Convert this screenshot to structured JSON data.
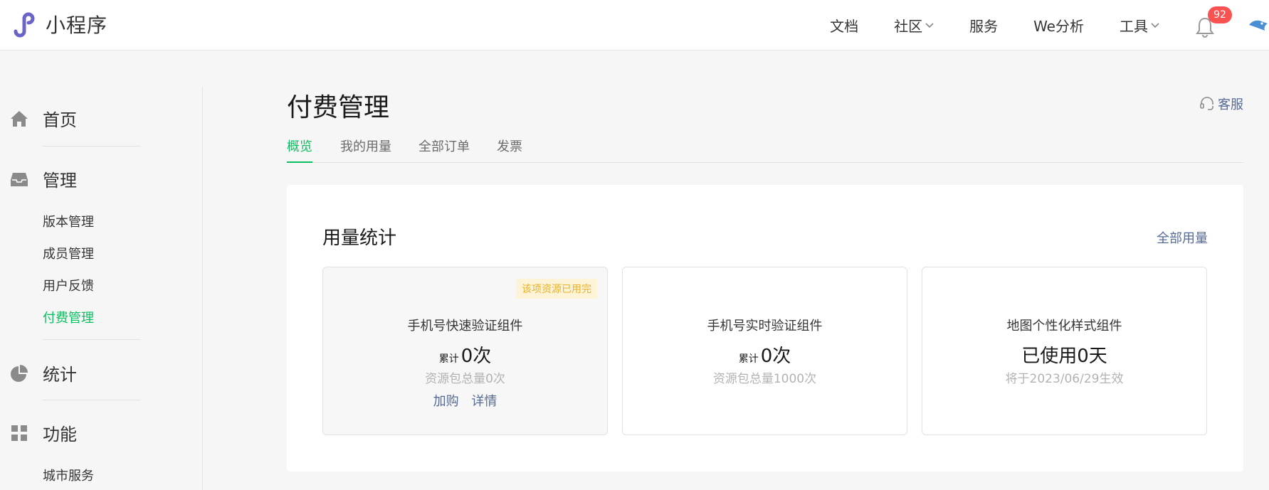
{
  "header": {
    "app_title": "小程序",
    "nav": [
      {
        "label": "文档",
        "has_dropdown": false
      },
      {
        "label": "社区",
        "has_dropdown": true
      },
      {
        "label": "服务",
        "has_dropdown": false
      },
      {
        "label": "We分析",
        "has_dropdown": false
      },
      {
        "label": "工具",
        "has_dropdown": true
      }
    ],
    "notification_count": "92",
    "brand_color": "#6b64c8"
  },
  "sidebar": {
    "sections": [
      {
        "label": "首页",
        "icon": "home-icon"
      },
      {
        "label": "管理",
        "icon": "inbox-icon",
        "items": [
          "版本管理",
          "成员管理",
          "用户反馈",
          "付费管理"
        ]
      },
      {
        "label": "统计",
        "icon": "pie-chart-icon"
      },
      {
        "label": "功能",
        "icon": "grid-icon",
        "items": [
          "城市服务"
        ]
      }
    ],
    "active_item": "付费管理",
    "accent_color": "#07c160"
  },
  "main": {
    "title": "付费管理",
    "support_label": "客服",
    "tabs": [
      "概览",
      "我的用量",
      "全部订单",
      "发票"
    ],
    "active_tab": "概览",
    "usage": {
      "title": "用量统计",
      "all_usage_link": "全部用量",
      "cards": [
        {
          "name": "手机号快速验证组件",
          "tag": "该项资源已用完",
          "count_prefix": "累计",
          "count_value": "0次",
          "sub": "资源包总量0次",
          "actions": [
            "加购",
            "详情"
          ]
        },
        {
          "name": "手机号实时验证组件",
          "count_prefix": "累计",
          "count_value": "0次",
          "sub": "资源包总量1000次"
        },
        {
          "name": "地图个性化样式组件",
          "big_value": "已使用0天",
          "sub": "将于2023/06/29生效"
        }
      ]
    }
  }
}
